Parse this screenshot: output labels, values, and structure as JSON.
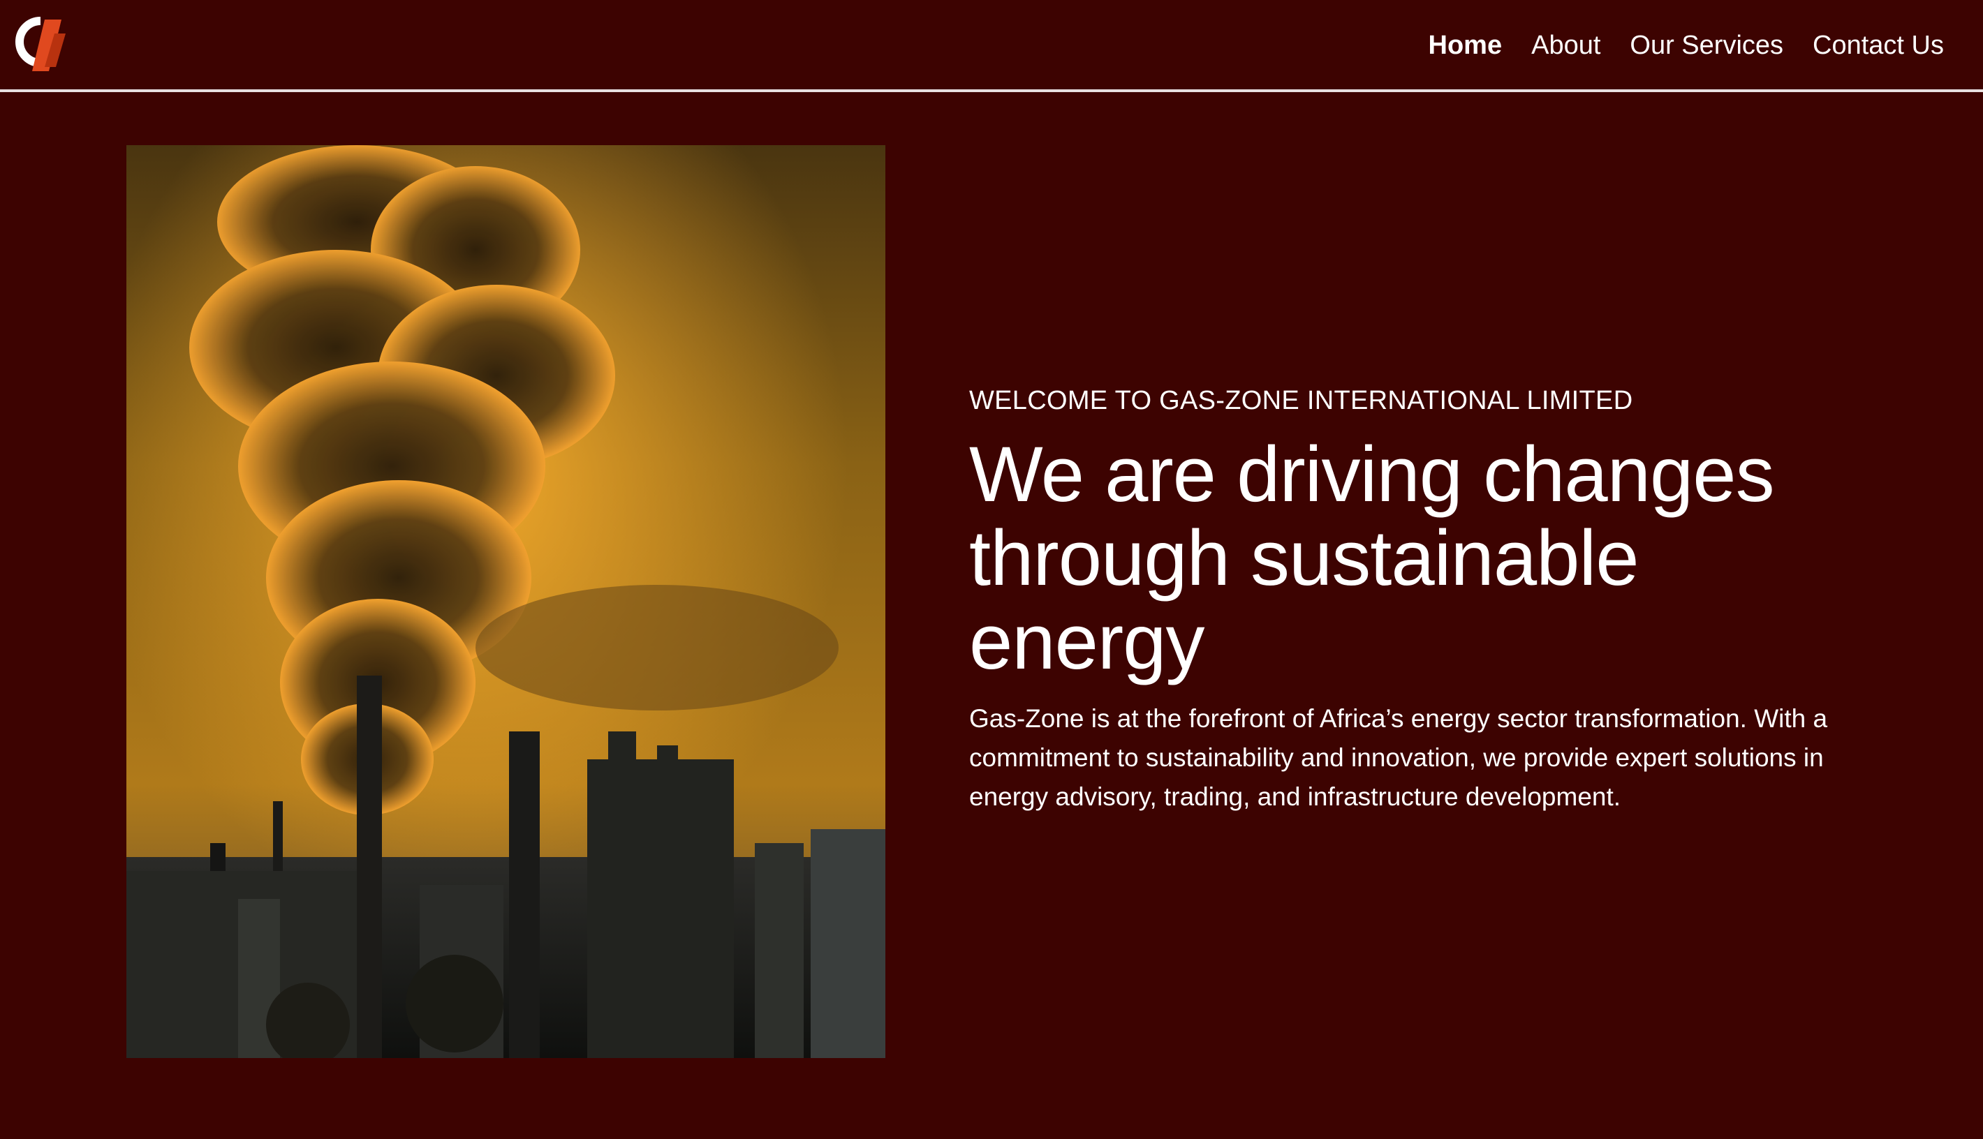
{
  "nav": {
    "logo_icon": "gas-zone-logo",
    "links": [
      {
        "label": "Home",
        "active": true
      },
      {
        "label": "About",
        "active": false
      },
      {
        "label": "Our Services",
        "active": false
      },
      {
        "label": "Contact Us",
        "active": false
      }
    ]
  },
  "hero": {
    "image_icon": "industrial-smokestack-photo",
    "eyebrow": "WELCOME TO GAS-ZONE INTERNATIONAL LIMITED",
    "headline": "We are driving changes through sustainable energy",
    "description": "Gas-Zone is at the forefront of Africa’s energy sector transformation. With a commitment to sustainability and innovation, we provide expert solutions in energy advisory, trading, and infrastructure development."
  },
  "colors": {
    "background": "#3d0301",
    "text": "#ffffff",
    "divider": "#e8e0e0",
    "logo_accent": "#e0491f"
  }
}
